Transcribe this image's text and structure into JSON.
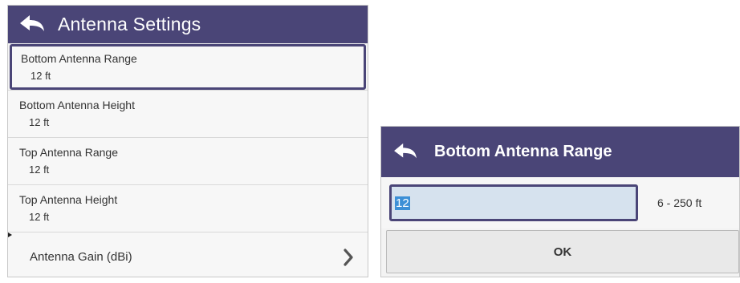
{
  "settings": {
    "title": "Antenna Settings",
    "items": [
      {
        "label": "Bottom Antenna Range",
        "value": "12 ft"
      },
      {
        "label": "Bottom Antenna Height",
        "value": "12 ft"
      },
      {
        "label": "Top Antenna Range",
        "value": "12 ft"
      },
      {
        "label": "Top Antenna Height",
        "value": "12 ft"
      },
      {
        "label": "Antenna Gain (dBi)"
      }
    ]
  },
  "dialog": {
    "title": "Bottom Antenna Range",
    "input_value": "12",
    "range": "6 - 250 ft",
    "ok_label": "OK"
  },
  "colors": {
    "header": "#4a4577",
    "selection_border": "#4a4577",
    "input_background": "#d6e2ee",
    "text_selection": "#3c8fd6"
  },
  "icons": {
    "back": "back-arrow-icon",
    "chevron": "chevron-right-icon"
  }
}
